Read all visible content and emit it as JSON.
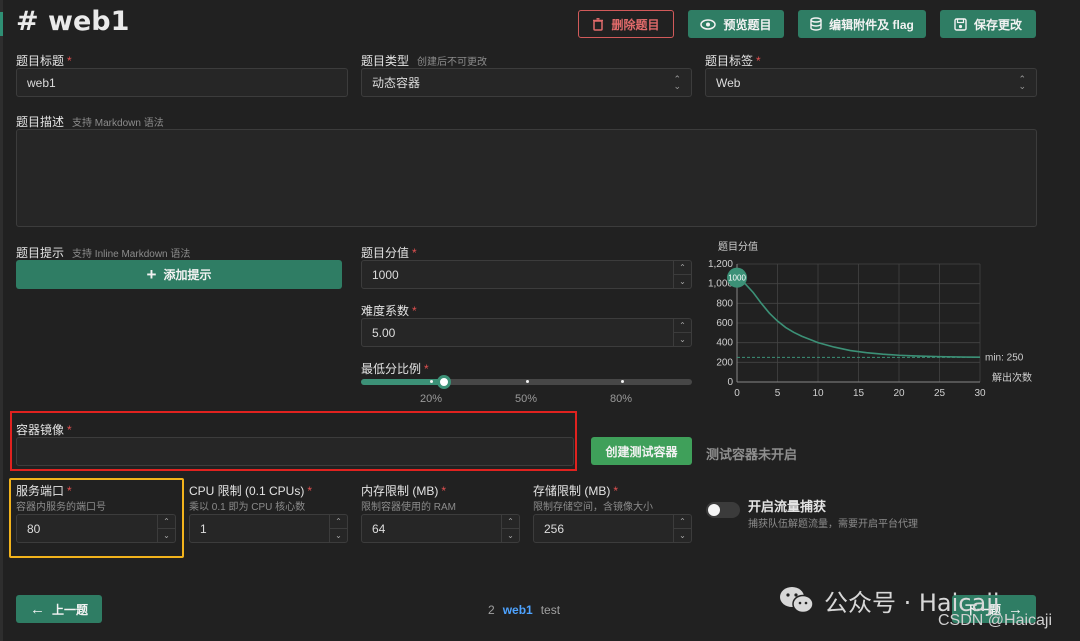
{
  "header": {
    "title": "# web1",
    "delete_label": "删除题目",
    "preview_label": "预览题目",
    "attach_label": "编辑附件及 flag",
    "save_label": "保存更改"
  },
  "fields": {
    "title_label": "题目标题",
    "title_value": "web1",
    "type_label": "题目类型",
    "type_hint": "创建后不可更改",
    "type_value": "动态容器",
    "tag_label": "题目标签",
    "tag_value": "Web",
    "desc_label": "题目描述",
    "desc_hint": "支持 Markdown 语法",
    "hint_label": "题目提示",
    "hint_hint": "支持 Inline Markdown 语法",
    "add_hint_label": "添加提示",
    "score_label": "题目分值",
    "score_value": "1000",
    "difficulty_label": "难度系数",
    "difficulty_value": "5.00",
    "min_ratio_label": "最低分比例",
    "min_ratio_value": 0.25,
    "min_ratio_marks": [
      "20%",
      "50%",
      "80%"
    ],
    "image_label": "容器镜像",
    "image_value": "",
    "create_test_label": "创建测试容器",
    "test_status": "测试容器未开启",
    "port_label": "服务端口",
    "port_hint": "容器内服务的端口号",
    "port_value": "80",
    "cpu_label": "CPU 限制 (0.1 CPUs)",
    "cpu_hint": "乘以 0.1 即为 CPU 核心数",
    "cpu_value": "1",
    "mem_label": "内存限制 (MB)",
    "mem_hint": "限制容器使用的 RAM",
    "mem_value": "64",
    "storage_label": "存储限制 (MB)",
    "storage_hint": "限制存储空间，含镜像大小",
    "storage_value": "256",
    "traffic_label": "开启流量捕获",
    "traffic_hint": "捕获队伍解题流量，需要开启平台代理"
  },
  "footer": {
    "prev_label": "上一题",
    "next_label": "下一题",
    "page_num": "2",
    "page_current": "web1",
    "page_next": "test"
  },
  "watermark": {
    "text": "公众号 · Haicaji",
    "csdn": "CSDN @Haicaji"
  },
  "colors": {
    "accent": "#2f7d64",
    "danger": "#d25a5a",
    "highlight_red": "#e0221f",
    "highlight_yellow": "#f2b31c"
  },
  "chart_data": {
    "type": "line",
    "title": "题目分值",
    "xlabel": "解出次数",
    "ylabel": "",
    "xlim": [
      0,
      30
    ],
    "ylim": [
      0,
      1200
    ],
    "xticks": [
      0,
      5,
      10,
      15,
      20,
      25,
      30
    ],
    "yticks": [
      0,
      200,
      400,
      600,
      800,
      1000,
      1200
    ],
    "ytick_labels": [
      "0",
      "200",
      "400",
      "600",
      "800",
      "1,000",
      "1,200"
    ],
    "marker_label": "1000",
    "min_label": "min: 250",
    "min_value": 250,
    "grid": true,
    "series": [
      {
        "x": [
          0,
          1,
          2,
          3,
          4,
          5,
          6,
          7,
          8,
          10,
          12,
          14,
          16,
          18,
          20,
          22,
          25,
          28,
          30
        ],
        "y": [
          1000,
          1000,
          910,
          800,
          700,
          620,
          555,
          505,
          465,
          400,
          355,
          320,
          298,
          283,
          272,
          265,
          258,
          254,
          252
        ]
      }
    ]
  }
}
